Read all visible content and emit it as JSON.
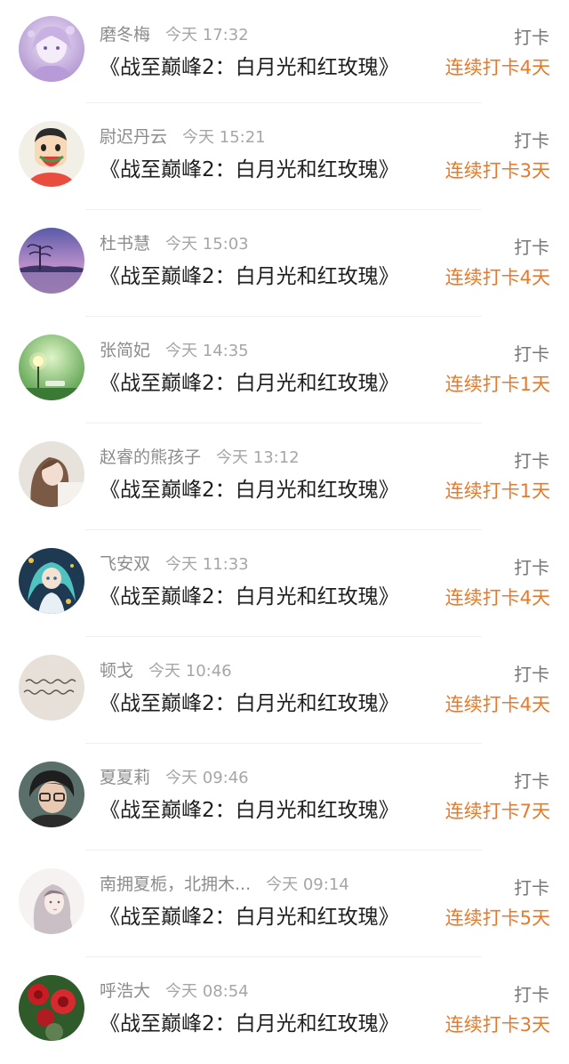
{
  "entries": [
    {
      "name": "磨冬梅",
      "time": "今天 17:32",
      "title": "《战至巅峰2：白月光和红玫瑰》",
      "action": "打卡",
      "streak": "连续打卡4天",
      "avatar_icon": "anime-girl-purple-avatar"
    },
    {
      "name": "尉迟丹云",
      "time": "今天 15:21",
      "title": "《战至巅峰2：白月光和红玫瑰》",
      "action": "打卡",
      "streak": "连续打卡3天",
      "avatar_icon": "cartoon-boy-watermelon-avatar"
    },
    {
      "name": "杜书慧",
      "time": "今天 15:03",
      "title": "《战至巅峰2：白月光和红玫瑰》",
      "action": "打卡",
      "streak": "连续打卡4天",
      "avatar_icon": "purple-sunset-tree-avatar"
    },
    {
      "name": "张简妃",
      "time": "今天 14:35",
      "title": "《战至巅峰2：白月光和红玫瑰》",
      "action": "打卡",
      "streak": "连续打卡1天",
      "avatar_icon": "green-garden-lamp-avatar"
    },
    {
      "name": "赵睿的熊孩子",
      "time": "今天 13:12",
      "title": "《战至巅峰2：白月光和红玫瑰》",
      "action": "打卡",
      "streak": "连续打卡1天",
      "avatar_icon": "girl-photo-avatar"
    },
    {
      "name": "飞安双",
      "time": "今天 11:33",
      "title": "《战至巅峰2：白月光和红玫瑰》",
      "action": "打卡",
      "streak": "连续打卡4天",
      "avatar_icon": "anime-character-teal-avatar"
    },
    {
      "name": "顿戈",
      "time": "今天 10:46",
      "title": "《战至巅峰2：白月光和红玫瑰》",
      "action": "打卡",
      "streak": "连续打卡4天",
      "avatar_icon": "handwriting-avatar"
    },
    {
      "name": "夏夏莉",
      "time": "今天 09:46",
      "title": "《战至巅峰2：白月光和红玫瑰》",
      "action": "打卡",
      "streak": "连续打卡7天",
      "avatar_icon": "boy-glasses-avatar"
    },
    {
      "name": "南拥夏栀，北拥木...",
      "time": "今天 09:14",
      "title": "《战至巅峰2：白月光和红玫瑰》",
      "action": "打卡",
      "streak": "连续打卡5天",
      "avatar_icon": "sketch-girl-avatar"
    },
    {
      "name": "呼浩大",
      "time": "今天 08:54",
      "title": "《战至巅峰2：白月光和红玫瑰》",
      "action": "打卡",
      "streak": "连续打卡3天",
      "avatar_icon": "red-flower-avatar"
    }
  ],
  "colors": {
    "streak": "#e67a2c",
    "name": "#8c8c8c",
    "title": "#1e1e1e"
  }
}
